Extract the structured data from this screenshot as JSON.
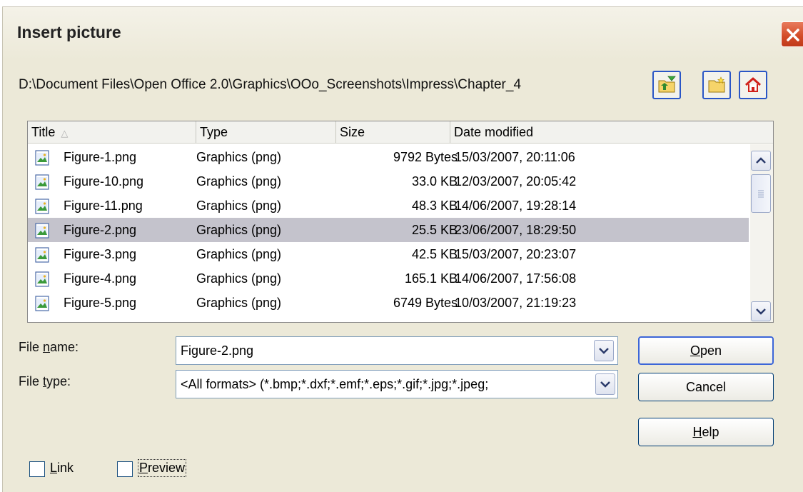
{
  "dialog": {
    "title": "Insert picture"
  },
  "path": "D:\\Document Files\\Open Office 2.0\\Graphics\\OOo_Screenshots\\Impress\\Chapter_4",
  "columns": {
    "title": "Title",
    "type": "Type",
    "size": "Size",
    "date": "Date modified"
  },
  "files": [
    {
      "title": "Figure-1.png",
      "type": "Graphics (png)",
      "size": "9792 Bytes",
      "date": "15/03/2007, 20:11:06"
    },
    {
      "title": "Figure-10.png",
      "type": "Graphics (png)",
      "size": "33.0 KB",
      "date": "12/03/2007, 20:05:42"
    },
    {
      "title": "Figure-11.png",
      "type": "Graphics (png)",
      "size": "48.3 KB",
      "date": "14/06/2007, 19:28:14"
    },
    {
      "title": "Figure-2.png",
      "type": "Graphics (png)",
      "size": "25.5 KB",
      "date": "23/06/2007, 18:29:50"
    },
    {
      "title": "Figure-3.png",
      "type": "Graphics (png)",
      "size": "42.5 KB",
      "date": "15/03/2007, 20:23:07"
    },
    {
      "title": "Figure-4.png",
      "type": "Graphics (png)",
      "size": "165.1 KB",
      "date": "14/06/2007, 17:56:08"
    },
    {
      "title": "Figure-5.png",
      "type": "Graphics (png)",
      "size": "6749 Bytes",
      "date": "10/03/2007, 21:19:23"
    }
  ],
  "selected_index": 3,
  "form": {
    "file_name_label": {
      "pre": "File ",
      "key": "n",
      "post": "ame:"
    },
    "file_name_value": "Figure-2.png",
    "file_type_label": {
      "pre": "File ",
      "key": "t",
      "post": "ype:"
    },
    "file_type_value": "<All formats> (*.bmp;*.dxf;*.emf;*.eps;*.gif;*.jpg;*.jpeg;"
  },
  "buttons": {
    "open": {
      "key": "O",
      "rest": "pen"
    },
    "cancel": "Cancel",
    "help": {
      "key": "H",
      "rest": "elp"
    }
  },
  "options": {
    "link": {
      "key": "L",
      "rest": "ink"
    },
    "preview": {
      "key": "P",
      "rest": "review"
    }
  },
  "colors": {
    "selection": "#c4c3cc",
    "close_button": "#d24a26",
    "accent_border": "#2a56c6"
  }
}
